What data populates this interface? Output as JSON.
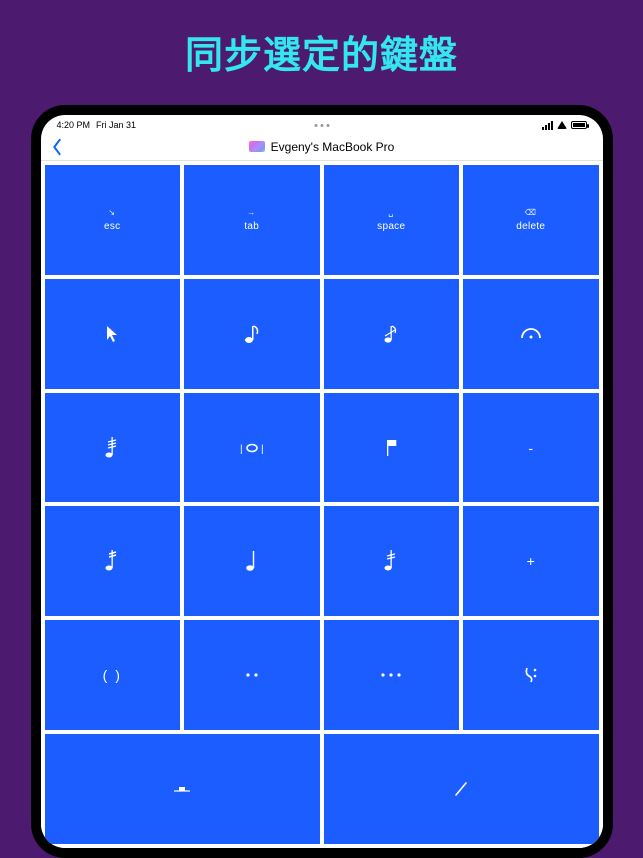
{
  "headline": "同步選定的鍵盤",
  "statusbar": {
    "time": "4:20 PM",
    "date": "Fri Jan 31"
  },
  "navbar": {
    "title": "Evgeny's MacBook Pro"
  },
  "keys": {
    "row1": [
      {
        "name": "esc-key",
        "sym": "↘",
        "label": "esc"
      },
      {
        "name": "tab-key",
        "sym": "→",
        "label": "tab"
      },
      {
        "name": "space-key",
        "sym": "␣",
        "label": "space"
      },
      {
        "name": "delete-key",
        "sym": "⌫",
        "label": "delete"
      }
    ],
    "dash": "-",
    "plus": "+",
    "parens_small": "( )",
    "parens": "( )",
    "dots2": "‥",
    "dots3": "…"
  }
}
